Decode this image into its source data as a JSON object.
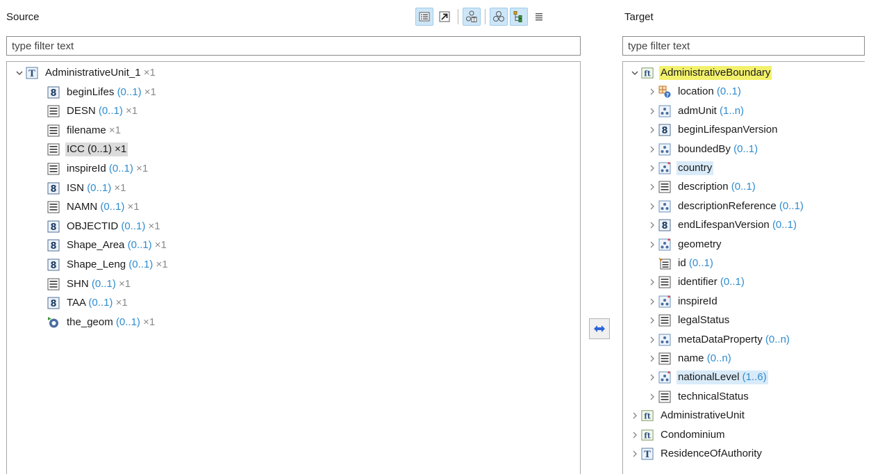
{
  "source": {
    "title": "Source",
    "filter_placeholder": "type filter text",
    "root": {
      "label": "AdministrativeUnit_1",
      "mult": "×1"
    },
    "items": [
      {
        "name": "beginLifes ",
        "card": "(0..1)",
        "mult": " ×1",
        "icon": "number-8-icon"
      },
      {
        "name": "DESN ",
        "card": "(0..1)",
        "mult": " ×1",
        "icon": "string-lines-icon"
      },
      {
        "name": "filename",
        "card": "",
        "mult": " ×1",
        "icon": "string-lines-icon"
      },
      {
        "name": "ICC (0..1) ×1",
        "card": "",
        "mult": "",
        "icon": "string-lines-icon"
      },
      {
        "name": "inspireId ",
        "card": "(0..1)",
        "mult": " ×1",
        "icon": "string-lines-icon"
      },
      {
        "name": "ISN ",
        "card": "(0..1)",
        "mult": " ×1",
        "icon": "number-8-icon"
      },
      {
        "name": "NAMN ",
        "card": "(0..1)",
        "mult": " ×1",
        "icon": "string-lines-icon"
      },
      {
        "name": "OBJECTID ",
        "card": "(0..1)",
        "mult": " ×1",
        "icon": "number-8-icon"
      },
      {
        "name": "Shape_Area ",
        "card": "(0..1)",
        "mult": " ×1",
        "icon": "number-8-icon"
      },
      {
        "name": "Shape_Leng ",
        "card": "(0..1)",
        "mult": " ×1",
        "icon": "number-8-icon"
      },
      {
        "name": "SHN ",
        "card": "(0..1)",
        "mult": " ×1",
        "icon": "string-lines-icon"
      },
      {
        "name": "TAA ",
        "card": "(0..1)",
        "mult": " ×1",
        "icon": "number-8-icon"
      },
      {
        "name": "the_geom ",
        "card": "(0..1)",
        "mult": " ×1",
        "icon": "geometry-ring-icon"
      }
    ]
  },
  "target": {
    "title": "Target",
    "filter_placeholder": "type filter text",
    "root": {
      "label": "AdministrativeBoundary"
    },
    "children": [
      {
        "name": "location ",
        "card": "(0..1)",
        "icon": "choice-icon"
      },
      {
        "name": "admUnit ",
        "card": "(1..n)",
        "icon": "complex-type-icon"
      },
      {
        "name": "beginLifespanVersion",
        "card": "",
        "icon": "number-8-icon"
      },
      {
        "name": "boundedBy ",
        "card": "(0..1)",
        "icon": "complex-type-icon"
      },
      {
        "name": "country",
        "card": "",
        "icon": "complex-type-required-icon"
      },
      {
        "name": "description ",
        "card": "(0..1)",
        "icon": "string-lines-icon"
      },
      {
        "name": "descriptionReference ",
        "card": "(0..1)",
        "icon": "complex-type-icon"
      },
      {
        "name": "endLifespanVersion ",
        "card": "(0..1)",
        "icon": "number-8-icon"
      },
      {
        "name": "geometry",
        "card": "",
        "icon": "complex-type-required-icon"
      },
      {
        "name": "id ",
        "card": "(0..1)",
        "icon": "attribute-id-icon"
      },
      {
        "name": "identifier ",
        "card": "(0..1)",
        "icon": "string-lines-icon"
      },
      {
        "name": "inspireId",
        "card": "",
        "icon": "complex-type-required-icon"
      },
      {
        "name": "legalStatus",
        "card": "",
        "icon": "string-lines-icon"
      },
      {
        "name": "metaDataProperty ",
        "card": "(0..n)",
        "icon": "complex-type-icon"
      },
      {
        "name": "name ",
        "card": "(0..n)",
        "icon": "string-lines-icon"
      },
      {
        "name": "nationalLevel ",
        "card": "(1..6)",
        "icon": "complex-type-required-icon"
      },
      {
        "name": "technicalStatus",
        "card": "",
        "icon": "string-lines-icon"
      }
    ],
    "siblings": [
      {
        "name": "AdministrativeUnit",
        "icon": "feature-type-icon"
      },
      {
        "name": "Condominium",
        "icon": "feature-type-icon"
      },
      {
        "name": "ResidenceOfAuthority",
        "icon": "type-t-icon"
      }
    ]
  },
  "colors": {
    "cardinality": "#2e8ccf",
    "highlight_yellow": "#f3f16c",
    "selection_blue": "#d9ebf9",
    "selection_grey": "#dcdcdc"
  }
}
